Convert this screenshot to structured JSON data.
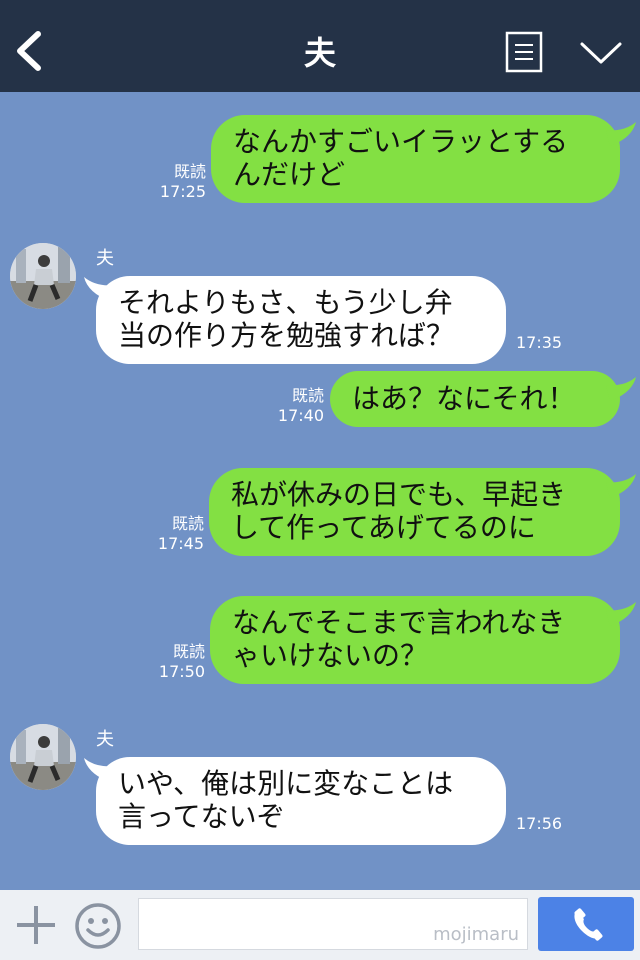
{
  "header": {
    "title": "夫",
    "back_icon": "chevron-left-icon",
    "menu_icon": "notes-icon",
    "collapse_icon": "chevron-down-icon"
  },
  "messages": [
    {
      "side": "me",
      "lines": [
        "なんかすごいイラッとする",
        "んだけど"
      ],
      "read": "既読",
      "time": "17:25"
    },
    {
      "side": "them",
      "sender": "夫",
      "lines": [
        "それよりもさ、もう少し弁",
        "当の作り方を勉強すれば？"
      ],
      "time": "17:35"
    },
    {
      "side": "me",
      "lines": [
        "はあ？なにそれ！"
      ],
      "read": "既読",
      "time": "17:40"
    },
    {
      "side": "me",
      "lines": [
        "私が休みの日でも、早起き",
        "して作ってあげてるのに"
      ],
      "read": "既読",
      "time": "17:45"
    },
    {
      "side": "me",
      "lines": [
        "なんでそこまで言われなき",
        "ゃいけないの？"
      ],
      "read": "既読",
      "time": "17:50"
    },
    {
      "side": "them",
      "sender": "夫",
      "lines": [
        "いや、俺は別に変なことは",
        "言ってないぞ"
      ],
      "time": "17:56"
    }
  ],
  "input": {
    "placeholder": "",
    "watermark": "mojimaru"
  },
  "colors": {
    "header_bg": "#243247",
    "chat_bg": "#7192c6",
    "my_bubble": "#83e043",
    "their_bubble": "#ffffff",
    "call_button": "#4c82e6"
  }
}
